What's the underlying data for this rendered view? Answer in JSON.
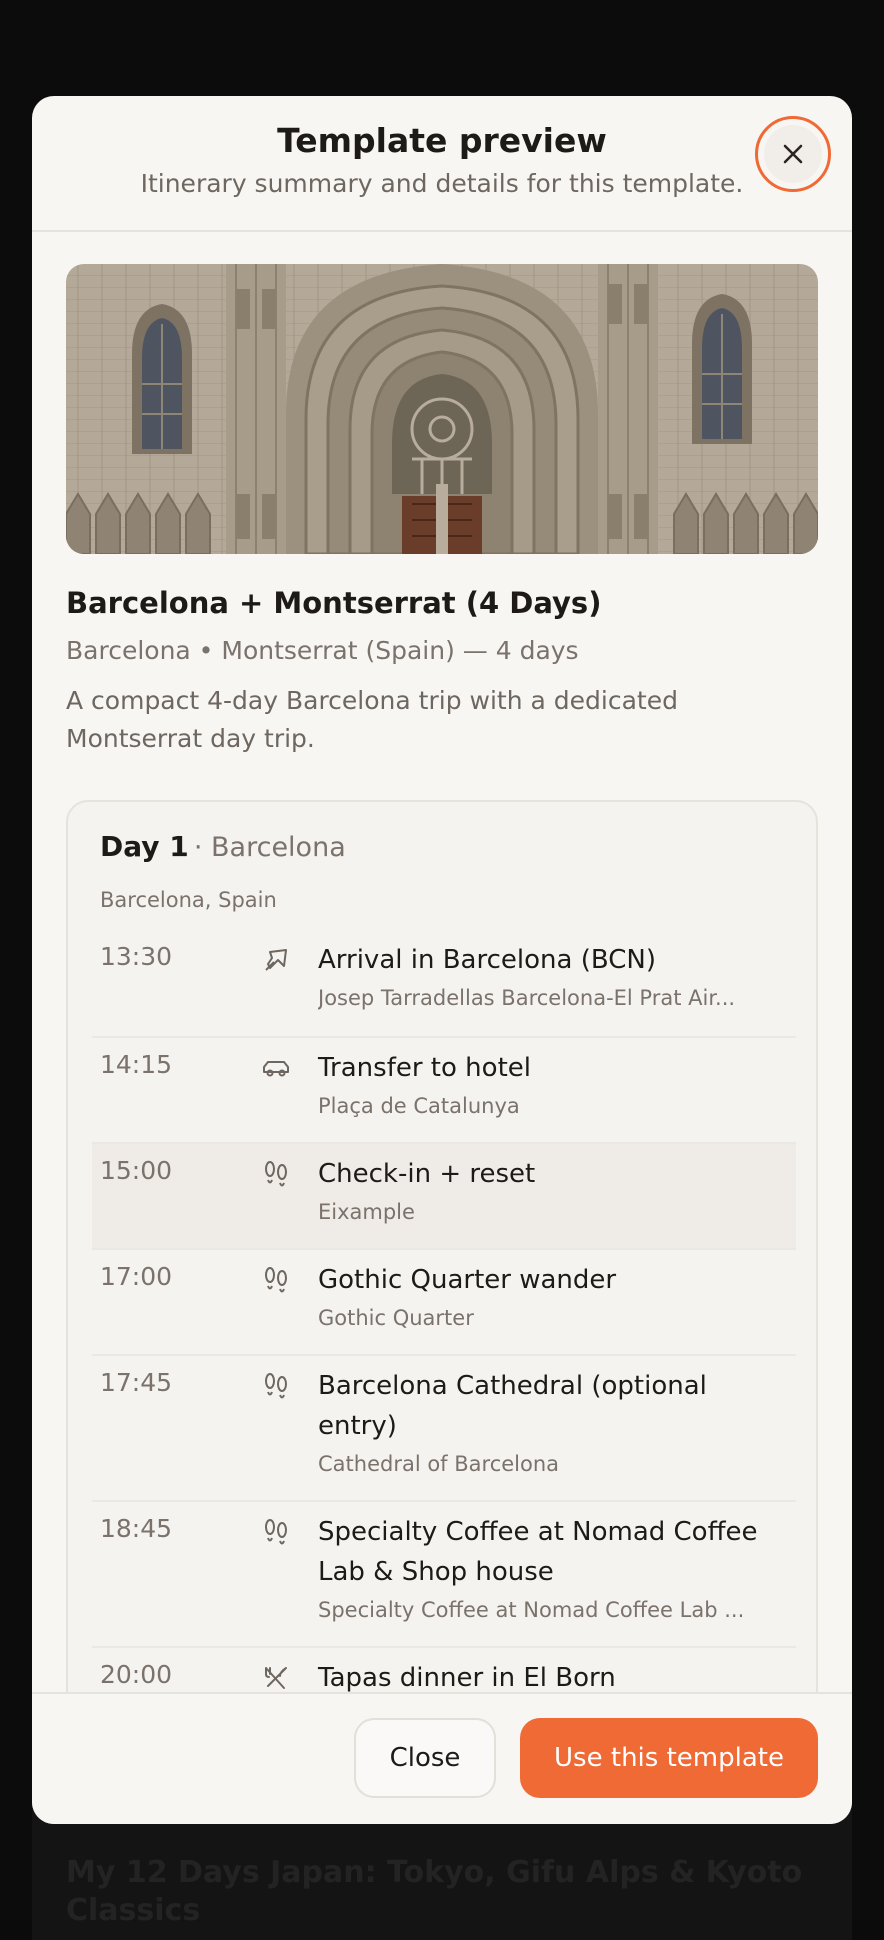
{
  "background": {
    "card_title": "My 12 Days Japan: Tokyo, Gifu Alps & Kyoto Classics"
  },
  "modal": {
    "title": "Template preview",
    "subtitle": "Itinerary summary and details for this template.",
    "close_icon": "close-icon"
  },
  "trip": {
    "title": "Barcelona + Montserrat (4 Days)",
    "meta": "Barcelona • Montserrat (Spain) — 4 days",
    "description": "A compact 4-day Barcelona trip with a dedicated Montserrat day trip."
  },
  "day": {
    "label": "Day 1",
    "city": "· Barcelona",
    "location": "Barcelona, Spain",
    "events": [
      {
        "time": "13:30",
        "icon": "plane-icon",
        "title": "Arrival in Barcelona (BCN)",
        "subtitle": "Josep Tarradellas Barcelona-El Prat Air..."
      },
      {
        "time": "14:15",
        "icon": "car-icon",
        "title": "Transfer to hotel",
        "subtitle": "Plaça de Catalunya"
      },
      {
        "time": "15:00",
        "icon": "footprints-icon",
        "title": "Check-in + reset",
        "subtitle": "Eixample"
      },
      {
        "time": "17:00",
        "icon": "footprints-icon",
        "title": "Gothic Quarter wander",
        "subtitle": "Gothic Quarter"
      },
      {
        "time": "17:45",
        "icon": "footprints-icon",
        "title": "Barcelona Cathedral (optional entry)",
        "subtitle": "Cathedral of Barcelona"
      },
      {
        "time": "18:45",
        "icon": "footprints-icon",
        "title": "Specialty Coffee at Nomad Coffee Lab & Shop house",
        "subtitle": "Specialty Coffee at Nomad Coffee Lab ..."
      },
      {
        "time": "20:00",
        "icon": "utensils-icon",
        "title": "Tapas dinner in El Born",
        "subtitle": ""
      }
    ]
  },
  "footer": {
    "close_label": "Close",
    "use_label": "Use this template"
  },
  "colors": {
    "accent": "#ef6a35",
    "surface": "#f8f6f3",
    "muted_text": "#7a726b"
  }
}
